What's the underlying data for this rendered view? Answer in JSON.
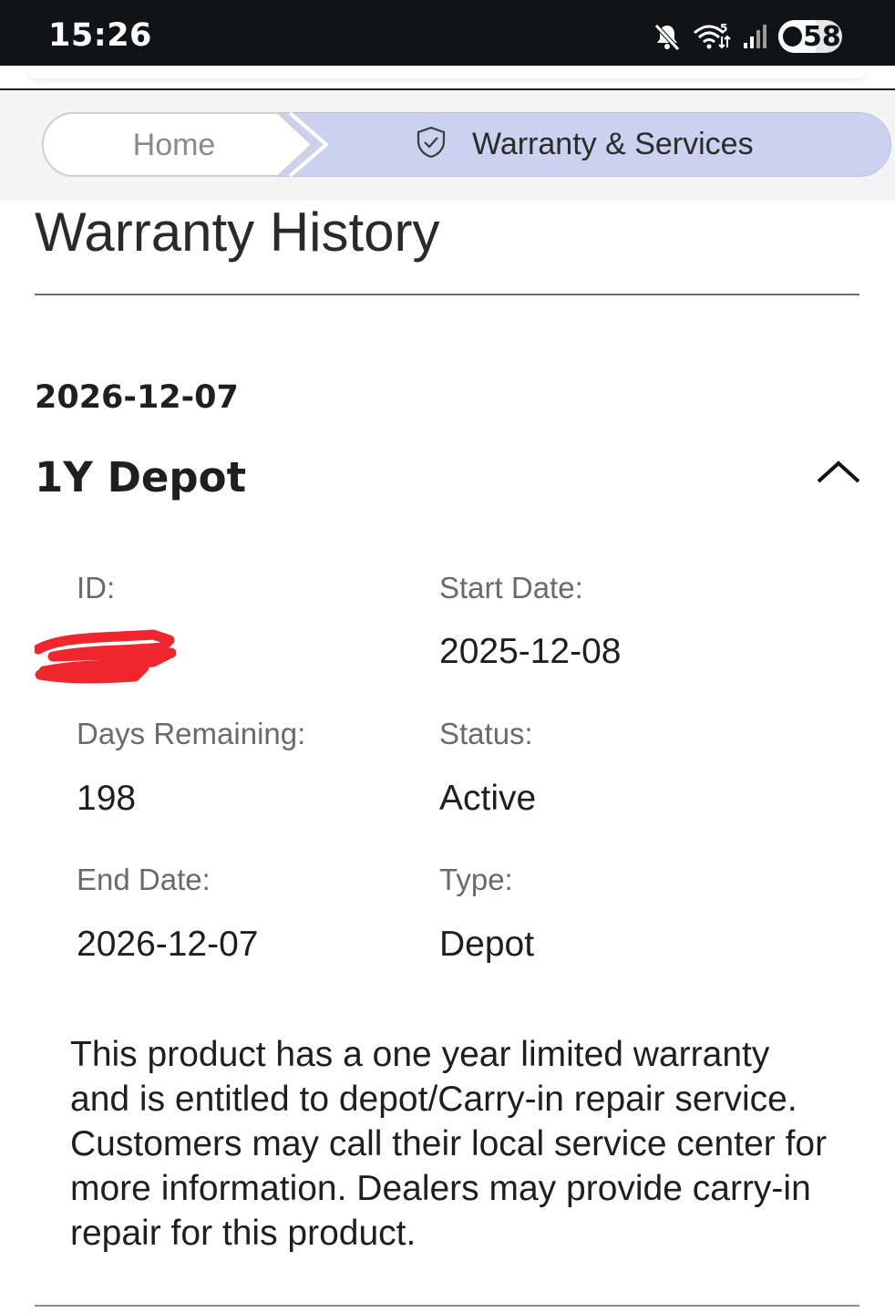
{
  "status_bar": {
    "time": "15:26",
    "icons": [
      "mute-icon",
      "wifi-icon",
      "signal-icon"
    ],
    "wifi_badge": "5",
    "battery_level": "58"
  },
  "breadcrumb": {
    "items": [
      {
        "label": "Home",
        "active": false
      },
      {
        "label": "Warranty & Services",
        "active": true,
        "icon": "shield-check-icon"
      }
    ]
  },
  "page": {
    "title": "Warranty History"
  },
  "warranty_entry": {
    "date": "2026-12-07",
    "name": "1Y Depot",
    "expanded": true,
    "fields": {
      "id_label": "ID:",
      "id_value_redacted": true,
      "start_date_label": "Start Date:",
      "start_date_value": "2025-12-08",
      "days_remaining_label": "Days Remaining:",
      "days_remaining_value": "198",
      "status_label": "Status:",
      "status_value": "Active",
      "end_date_label": "End Date:",
      "end_date_value": "2026-12-07",
      "type_label": "Type:",
      "type_value": "Depot"
    },
    "description": "This product has a one year limited warranty and is entitled to depot/Carry-in repair service. Customers may call their local service center for more information. Dealers may provide carry-in repair for this product."
  },
  "colors": {
    "status_bar_bg": "#111417",
    "breadcrumb_active_bg": "#cbd2ef",
    "redaction": "#f0262e"
  }
}
